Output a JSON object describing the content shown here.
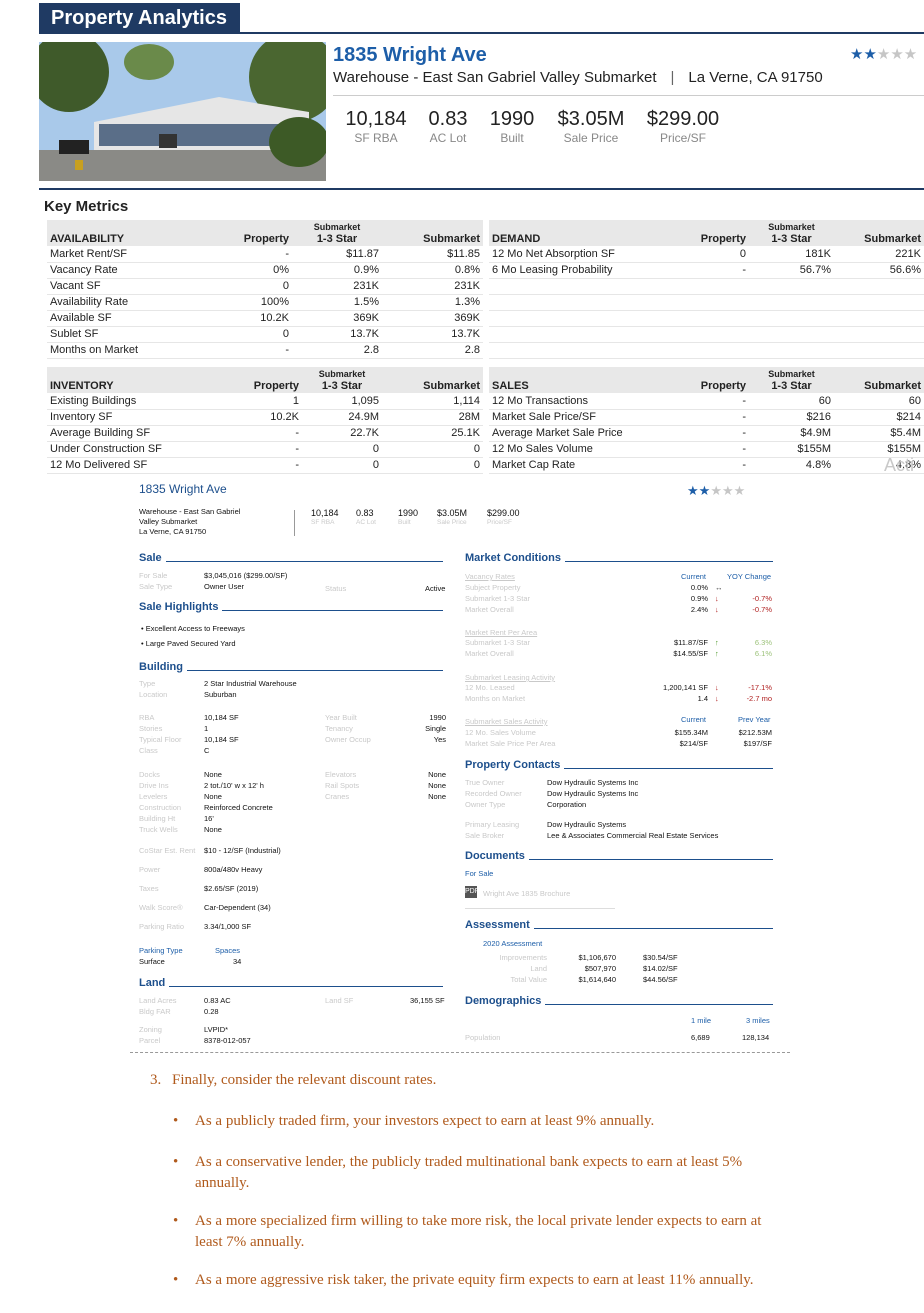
{
  "banner": "Property Analytics",
  "property": {
    "address": "1835 Wright Ave",
    "subtitle": "Warehouse - East San Gabriel Valley Submarket",
    "location": "La Verne, CA 91750",
    "rating_stars": 2,
    "photo": "warehouse-building-photo"
  },
  "kpis": [
    {
      "value": "10,184",
      "label": "SF RBA"
    },
    {
      "value": "0.83",
      "label": "AC Lot"
    },
    {
      "value": "1990",
      "label": "Built"
    },
    {
      "value": "$3.05M",
      "label": "Sale Price"
    },
    {
      "value": "$299.00",
      "label": "Price/SF"
    }
  ],
  "key_metrics_title": "Key Metrics",
  "availability": {
    "title": "AVAILABILITY",
    "cols": [
      "Property",
      "Submarket",
      "1-3 Star",
      "Submarket"
    ],
    "rows": [
      [
        "Market Rent/SF",
        "-",
        "$11.87",
        "$11.85"
      ],
      [
        "Vacancy Rate",
        "0%",
        "0.9%",
        "0.8%"
      ],
      [
        "Vacant SF",
        "0",
        "231K",
        "231K"
      ],
      [
        "Availability Rate",
        "100%",
        "1.5%",
        "1.3%"
      ],
      [
        "Available SF",
        "10.2K",
        "369K",
        "369K"
      ],
      [
        "Sublet SF",
        "0",
        "13.7K",
        "13.7K"
      ],
      [
        "Months on Market",
        "-",
        "2.8",
        "2.8"
      ]
    ]
  },
  "demand": {
    "title": "DEMAND",
    "cols": [
      "Property",
      "Submarket",
      "1-3 Star",
      "Submarket"
    ],
    "rows": [
      [
        "12 Mo Net Absorption SF",
        "0",
        "181K",
        "221K"
      ],
      [
        "6 Mo Leasing Probability",
        "-",
        "56.7%",
        "56.6%"
      ]
    ]
  },
  "inventory": {
    "title": "INVENTORY",
    "cols": [
      "Property",
      "Submarket",
      "1-3 Star",
      "Submarket"
    ],
    "rows": [
      [
        "Existing Buildings",
        "1",
        "1,095",
        "1,114"
      ],
      [
        "Inventory SF",
        "10.2K",
        "24.9M",
        "28M"
      ],
      [
        "Average Building SF",
        "-",
        "22.7K",
        "25.1K"
      ],
      [
        "Under Construction SF",
        "-",
        "0",
        "0"
      ],
      [
        "12 Mo Delivered SF",
        "-",
        "0",
        "0"
      ]
    ]
  },
  "sales": {
    "title": "SALES",
    "cols": [
      "Property",
      "Submarket",
      "1-3 Star",
      "Submarket"
    ],
    "rows": [
      [
        "12 Mo Transactions",
        "-",
        "60",
        "60"
      ],
      [
        "Market Sale Price/SF",
        "-",
        "$216",
        "$214"
      ],
      [
        "Average Market Sale Price",
        "-",
        "$4.9M",
        "$5.4M"
      ],
      [
        "12 Mo Sales Volume",
        "-",
        "$155M",
        "$155M"
      ],
      [
        "Market Cap Rate",
        "-",
        "4.8%",
        "4.8%"
      ]
    ],
    "watermark": "Acti"
  },
  "report": {
    "address": "1835 Wright Ave",
    "sub1": "Warehouse - East San Gabriel",
    "sub2": "Valley Submarket",
    "sub3": "La Verne, CA 91750",
    "kpi_vals": [
      "10,184",
      "0.83",
      "1990",
      "$3.05M",
      "$299.00"
    ],
    "kpi_labels": [
      "SF RBA",
      "AC Lot",
      "Built",
      "Sale Price",
      "Price/SF"
    ],
    "sale_h": "Sale",
    "sale_rows": [
      [
        "For Sale",
        "$3,045,016 ($299.00/SF)"
      ],
      [
        "Sale Type",
        "Owner User"
      ]
    ],
    "status_l": "Status",
    "status_v": "Active",
    "highlights_h": "Sale Highlights",
    "highlights": [
      "Excellent Access to Freeways",
      "Large Paved Secured Yard"
    ],
    "building_h": "Building",
    "b_type_l": "Type",
    "b_type_v": "2 Star Industrial Warehouse",
    "b_loc_l": "Location",
    "b_loc_v": "Suburban",
    "b_left": [
      [
        "RBA",
        "10,184 SF"
      ],
      [
        "Stories",
        "1"
      ],
      [
        "Typical Floor",
        "10,184 SF"
      ],
      [
        "Class",
        "C"
      ]
    ],
    "b_right": [
      [
        "Year Built",
        "1990"
      ],
      [
        "Tenancy",
        "Single"
      ],
      [
        "Owner Occup",
        "Yes"
      ]
    ],
    "b_left2": [
      [
        "Docks",
        "None"
      ],
      [
        "Drive Ins",
        "2 tot./10' w x 12' h"
      ],
      [
        "Levelers",
        "None"
      ],
      [
        "Construction",
        "Reinforced Concrete"
      ],
      [
        "Building Ht",
        "16'"
      ],
      [
        "Truck Wells",
        "None"
      ]
    ],
    "b_right2": [
      [
        "Elevators",
        "None"
      ],
      [
        "Rail Spots",
        "None"
      ],
      [
        "Cranes",
        "None"
      ]
    ],
    "b_more": [
      [
        "CoStar Est. Rent",
        "$10 - 12/SF (Industrial)"
      ],
      [
        "Power",
        "800a/480v Heavy"
      ],
      [
        "Taxes",
        "$2.65/SF (2019)"
      ],
      [
        "Walk Score®",
        "Car-Dependent (34)"
      ],
      [
        "Parking Ratio",
        "3.34/1,000 SF"
      ]
    ],
    "park_type_l": "Parking Type",
    "park_spaces_l": "Spaces",
    "park_type_v": "Surface",
    "park_spaces_v": "34",
    "land_h": "Land",
    "land_rows": [
      [
        "Land Acres",
        "0.83 AC"
      ],
      [
        "Bldg FAR",
        "0.28"
      ],
      [
        "Zoning",
        "LVPID*"
      ],
      [
        "Parcel",
        "8378-012-057"
      ]
    ],
    "land_sf_l": "Land SF",
    "land_sf_v": "36,155 SF",
    "mc_h": "Market Conditions",
    "mc_cur": "Current",
    "mc_yoy": "YOY Change",
    "vac_h": "Vacancy Rates",
    "vac": [
      [
        "Subject Property",
        "0.0%",
        "↔",
        ""
      ],
      [
        "Submarket 1-3 Star",
        "0.9%",
        "↓",
        "-0.7%"
      ],
      [
        "Market Overall",
        "2.4%",
        "↓",
        "-0.7%"
      ]
    ],
    "rent_h": "Market Rent Per Area",
    "rent": [
      [
        "Submarket 1-3 Star",
        "$11.87/SF",
        "↑",
        "6.3%"
      ],
      [
        "Market Overall",
        "$14.55/SF",
        "↑",
        "6.1%"
      ]
    ],
    "lease_h": "Submarket Leasing Activity",
    "lease": [
      [
        "12 Mo. Leased",
        "1,200,141 SF",
        "↓",
        "-17.1%"
      ],
      [
        "Months on Market",
        "1.4",
        "↓",
        "-2.7 mo"
      ]
    ],
    "salesact_h": "Submarket Sales Activity",
    "sa_cur": "Current",
    "sa_prev": "Prev Year",
    "salesact": [
      [
        "12 Mo. Sales Volume",
        "$155.34M",
        "$212.53M"
      ],
      [
        "Market Sale Price Per Area",
        "$214/SF",
        "$197/SF"
      ]
    ],
    "pc_h": "Property Contacts",
    "pc": [
      [
        "True Owner",
        "Dow Hydraulic Systems Inc"
      ],
      [
        "Recorded Owner",
        "Dow Hydraulic Systems Inc"
      ],
      [
        "Owner Type",
        "Corporation"
      ]
    ],
    "pc2": [
      [
        "Primary Leasing",
        "Dow Hydraulic Systems"
      ],
      [
        "Sale Broker",
        "Lee & Associates Commercial Real Estate Services"
      ]
    ],
    "docs_h": "Documents",
    "docs_for_sale": "For Sale",
    "doc_name": "Wright Ave 1835 Brochure",
    "assess_h": "Assessment",
    "assess_year": "2020 Assessment",
    "assess": [
      [
        "Improvements",
        "$1,106,670",
        "$30.54/SF"
      ],
      [
        "Land",
        "$507,970",
        "$14.02/SF"
      ],
      [
        "Total Value",
        "$1,614,640",
        "$44.56/SF"
      ]
    ],
    "demo_h": "Demographics",
    "demo_1mi": "1 mile",
    "demo_3mi": "3 miles",
    "demo_pop_l": "Population",
    "demo_pop_1": "6,689",
    "demo_pop_3": "128,134"
  },
  "text": {
    "item3_num": "3.",
    "item3": "Finally, consider the relevant discount rates.",
    "bullets": [
      "As a publicly traded firm, your investors expect to earn at least 9% annually.",
      "As a conservative lender, the publicly traded multinational bank expects to earn at least 5% annually.",
      "As a more specialized firm willing to take more risk, the local private lender expects to earn at least 7% annually.",
      "As a more aggressive risk taker, the private equity firm expects to earn at least 11% annually."
    ]
  },
  "colors": {
    "brand": "#1f3a63",
    "accent": "#1d5ea8",
    "down": "#b02020",
    "up": "#4f9a2c",
    "text_orange": "#b05a1c"
  }
}
